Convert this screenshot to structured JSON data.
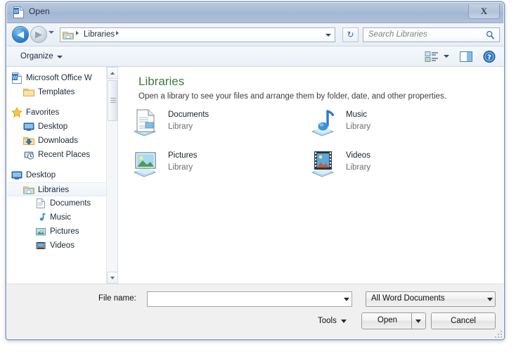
{
  "window": {
    "title": "Open",
    "title_icon": "word-document-icon",
    "close_label": "X"
  },
  "addressbar": {
    "back_icon": "back-arrow-icon",
    "back_glyph": "◀",
    "forward_icon": "forward-arrow-icon",
    "forward_glyph": "▶",
    "history_icon": "chevron-down-icon",
    "folder_icon": "libraries-folder-icon",
    "crumb": "Libraries",
    "dropdown_icon": "chevron-down-icon",
    "refresh_icon": "refresh-icon",
    "refresh_glyph": "↻"
  },
  "search": {
    "placeholder": "Search Libraries",
    "icon": "search-icon"
  },
  "toolbar": {
    "organize_label": "Organize",
    "organize_caret_icon": "chevron-down-icon",
    "view_icon": "change-view-icon",
    "view_caret_icon": "chevron-down-icon",
    "preview_pane_icon": "preview-pane-icon",
    "help_icon": "help-icon"
  },
  "sidebar": {
    "items": [
      {
        "label": "Microsoft Office W",
        "icon": "word-document-icon",
        "indent": 7,
        "selected": false
      },
      {
        "label": "Templates",
        "icon": "folder-icon",
        "indent": 24,
        "selected": false
      },
      {
        "label": "Favorites",
        "icon": "star-icon",
        "indent": 7,
        "selected": false
      },
      {
        "label": "Desktop",
        "icon": "desktop-icon",
        "indent": 24,
        "selected": false
      },
      {
        "label": "Downloads",
        "icon": "downloads-folder-icon",
        "indent": 24,
        "selected": false
      },
      {
        "label": "Recent Places",
        "icon": "recent-places-icon",
        "indent": 24,
        "selected": false
      },
      {
        "label": "Desktop",
        "icon": "desktop-icon",
        "indent": 7,
        "selected": false
      },
      {
        "label": "Libraries",
        "icon": "libraries-folder-icon",
        "indent": 24,
        "selected": true
      },
      {
        "label": "Documents",
        "icon": "documents-library-icon",
        "indent": 41,
        "selected": false
      },
      {
        "label": "Music",
        "icon": "music-library-icon",
        "indent": 41,
        "selected": false
      },
      {
        "label": "Pictures",
        "icon": "pictures-library-icon",
        "indent": 41,
        "selected": false
      },
      {
        "label": "Videos",
        "icon": "videos-library-icon",
        "indent": 41,
        "selected": false
      }
    ],
    "scrollbar": {
      "up_icon": "scroll-up-icon",
      "down_icon": "scroll-down-icon",
      "thumb": "scroll-thumb"
    }
  },
  "content": {
    "heading": "Libraries",
    "heading_color": "#3d7a44",
    "subtitle": "Open a library to see your files and arrange them by folder, date, and other properties.",
    "items": [
      {
        "name": "Documents",
        "type": "Library",
        "icon": "documents-library-icon"
      },
      {
        "name": "Music",
        "type": "Library",
        "icon": "music-library-icon"
      },
      {
        "name": "Pictures",
        "type": "Library",
        "icon": "pictures-library-icon"
      },
      {
        "name": "Videos",
        "type": "Library",
        "icon": "videos-library-icon"
      }
    ]
  },
  "footer": {
    "filename_label": "File name:",
    "filename_value": "",
    "filename_caret_icon": "chevron-down-icon",
    "filter_value": "All Word Documents",
    "filter_caret_icon": "chevron-down-icon",
    "tools_label": "Tools",
    "tools_caret_icon": "chevron-down-icon",
    "open_label": "Open",
    "open_caret_icon": "chevron-down-icon",
    "cancel_label": "Cancel"
  }
}
